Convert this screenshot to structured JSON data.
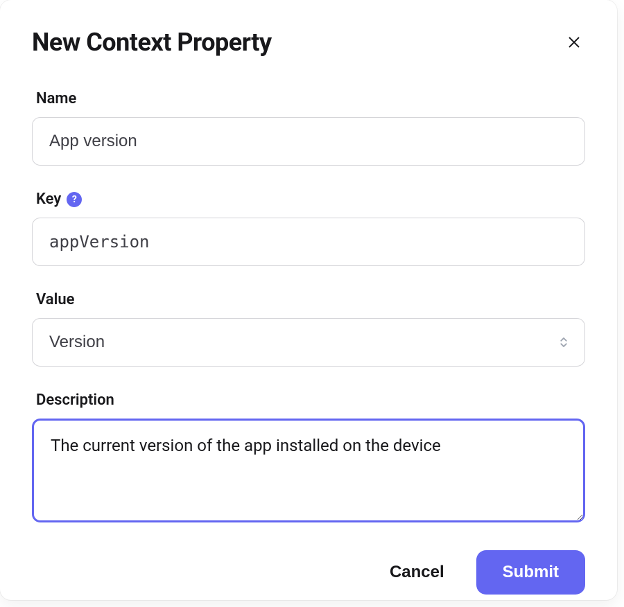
{
  "modal": {
    "title": "New Context Property",
    "fields": {
      "name": {
        "label": "Name",
        "value": "App version"
      },
      "key": {
        "label": "Key",
        "value": "appVersion",
        "help_icon": "?"
      },
      "value": {
        "label": "Value",
        "selected": "Version"
      },
      "description": {
        "label": "Description",
        "value": "The current version of the app installed on the device"
      }
    },
    "buttons": {
      "cancel": "Cancel",
      "submit": "Submit"
    }
  }
}
